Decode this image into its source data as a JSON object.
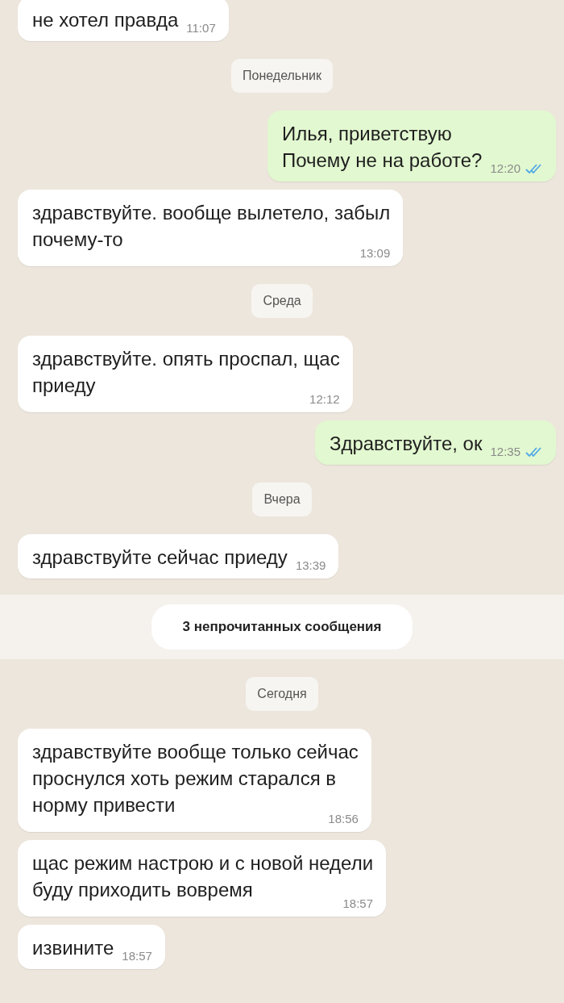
{
  "chat": [
    {
      "kind": "message",
      "outgoing": false,
      "text": "не хотел правда",
      "time": "11:07"
    },
    {
      "kind": "date",
      "text": "Понедельник"
    },
    {
      "kind": "message",
      "outgoing": true,
      "text": "Илья, приветствую\nПочему не на работе?",
      "time": "12:20",
      "read": true
    },
    {
      "kind": "message",
      "outgoing": false,
      "text": "здравствуйте. вообще вылетело, забыл\nпочему-то",
      "time": "13:09"
    },
    {
      "kind": "date",
      "text": "Среда"
    },
    {
      "kind": "message",
      "outgoing": false,
      "text": "здравствуйте. опять проспал, щас\nприеду",
      "time": "12:12"
    },
    {
      "kind": "message",
      "outgoing": true,
      "text": "Здравствуйте, ок",
      "time": "12:35",
      "read": true
    },
    {
      "kind": "date",
      "text": "Вчера"
    },
    {
      "kind": "message",
      "outgoing": false,
      "text": "здравствуйте сейчас приеду",
      "time": "13:39"
    },
    {
      "kind": "unread",
      "text": "3 непрочитанных сообщения"
    },
    {
      "kind": "date",
      "text": "Сегодня"
    },
    {
      "kind": "message",
      "outgoing": false,
      "text": "здравствуйте вообще только сейчас\nпроснулся хоть режим старался в\nнорму привести",
      "time": "18:56"
    },
    {
      "kind": "message",
      "outgoing": false,
      "text": "щас режим настрою и с новой недели\nбуду приходить вовремя",
      "time": "18:57"
    },
    {
      "kind": "message",
      "outgoing": false,
      "text": "извините",
      "time": "18:57"
    }
  ]
}
